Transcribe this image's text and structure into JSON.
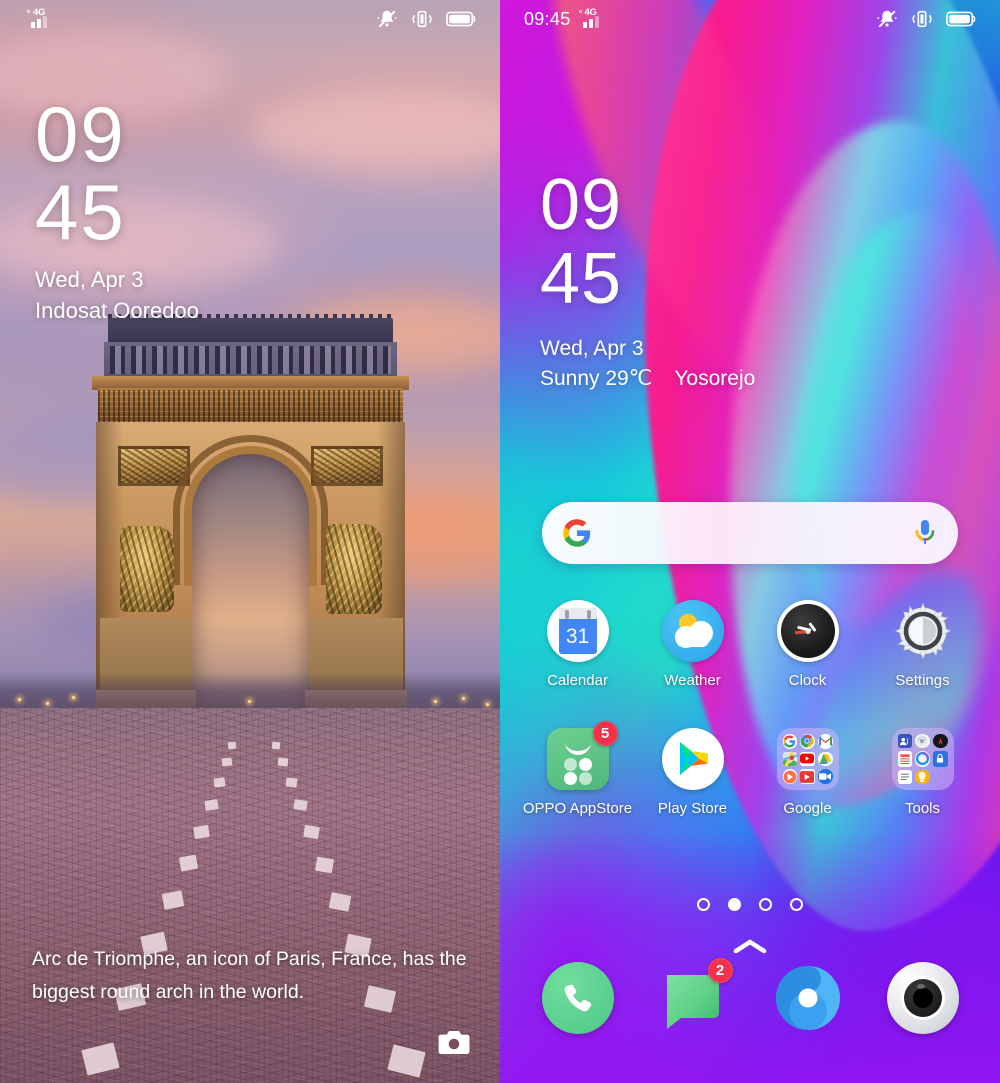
{
  "lockscreen": {
    "statusbar": {
      "network_label": "4G",
      "icons": [
        "mute-bell-icon",
        "vibrate-icon",
        "battery-icon"
      ]
    },
    "clock": {
      "hours": "09",
      "minutes": "45"
    },
    "date": "Wed, Apr 3",
    "carrier": "Indosat Ooredoo",
    "wallpaper_caption": "Arc de Triomphe, an icon of Paris, France, has the biggest round arch in the world.",
    "camera_shortcut": "camera-icon"
  },
  "homescreen": {
    "statusbar": {
      "time": "09:45",
      "network_label": "4G",
      "icons": [
        "mute-bell-icon",
        "vibrate-icon",
        "battery-icon"
      ]
    },
    "clock": {
      "hours": "09",
      "minutes": "45"
    },
    "date": "Wed, Apr 3",
    "weather": "Sunny 29℃",
    "location": "Yosorejo",
    "search": {
      "placeholder": "",
      "value": "",
      "leading_icon": "google-g-icon",
      "trailing_icon": "microphone-icon"
    },
    "apps": [
      [
        {
          "label": "Calendar",
          "icon": "calendar-icon",
          "day": "31",
          "badge": null
        },
        {
          "label": "Weather",
          "icon": "weather-icon",
          "badge": null
        },
        {
          "label": "Clock",
          "icon": "clock-icon",
          "badge": null
        },
        {
          "label": "Settings",
          "icon": "settings-icon",
          "badge": null
        }
      ],
      [
        {
          "label": "OPPO AppStore",
          "icon": "oppo-appstore-icon",
          "badge": "5"
        },
        {
          "label": "Play Store",
          "icon": "play-store-icon",
          "badge": null
        },
        {
          "label": "Google",
          "icon": "folder-google",
          "badge": null,
          "folder": [
            "G",
            "Chrome",
            "Gmail",
            "Maps",
            "YouTube",
            "Drive",
            "Play Music",
            "Play Movies",
            "Duo"
          ]
        },
        {
          "label": "Tools",
          "icon": "folder-tools",
          "badge": null,
          "folder": [
            "Contacts",
            "Recorder",
            "Compass",
            "Calculator",
            "Theme Store",
            "Security",
            "Notes",
            "Flashlight"
          ]
        }
      ]
    ],
    "pages": {
      "count": 4,
      "active": 2
    },
    "drawer_handle": "chevron-up-icon",
    "dock": [
      {
        "label": "Phone",
        "icon": "phone-icon",
        "badge": null
      },
      {
        "label": "Messages",
        "icon": "messages-icon",
        "badge": "2"
      },
      {
        "label": "Browser",
        "icon": "browser-icon",
        "badge": null
      },
      {
        "label": "Camera",
        "icon": "camera-app-icon",
        "badge": null
      }
    ]
  },
  "colors": {
    "badge_red": "#f4314a",
    "oppo_green": "#62c98b",
    "phone_green": "#55d18a",
    "browser_blue": "#3aa0ef",
    "accent_white": "#ffffff"
  }
}
